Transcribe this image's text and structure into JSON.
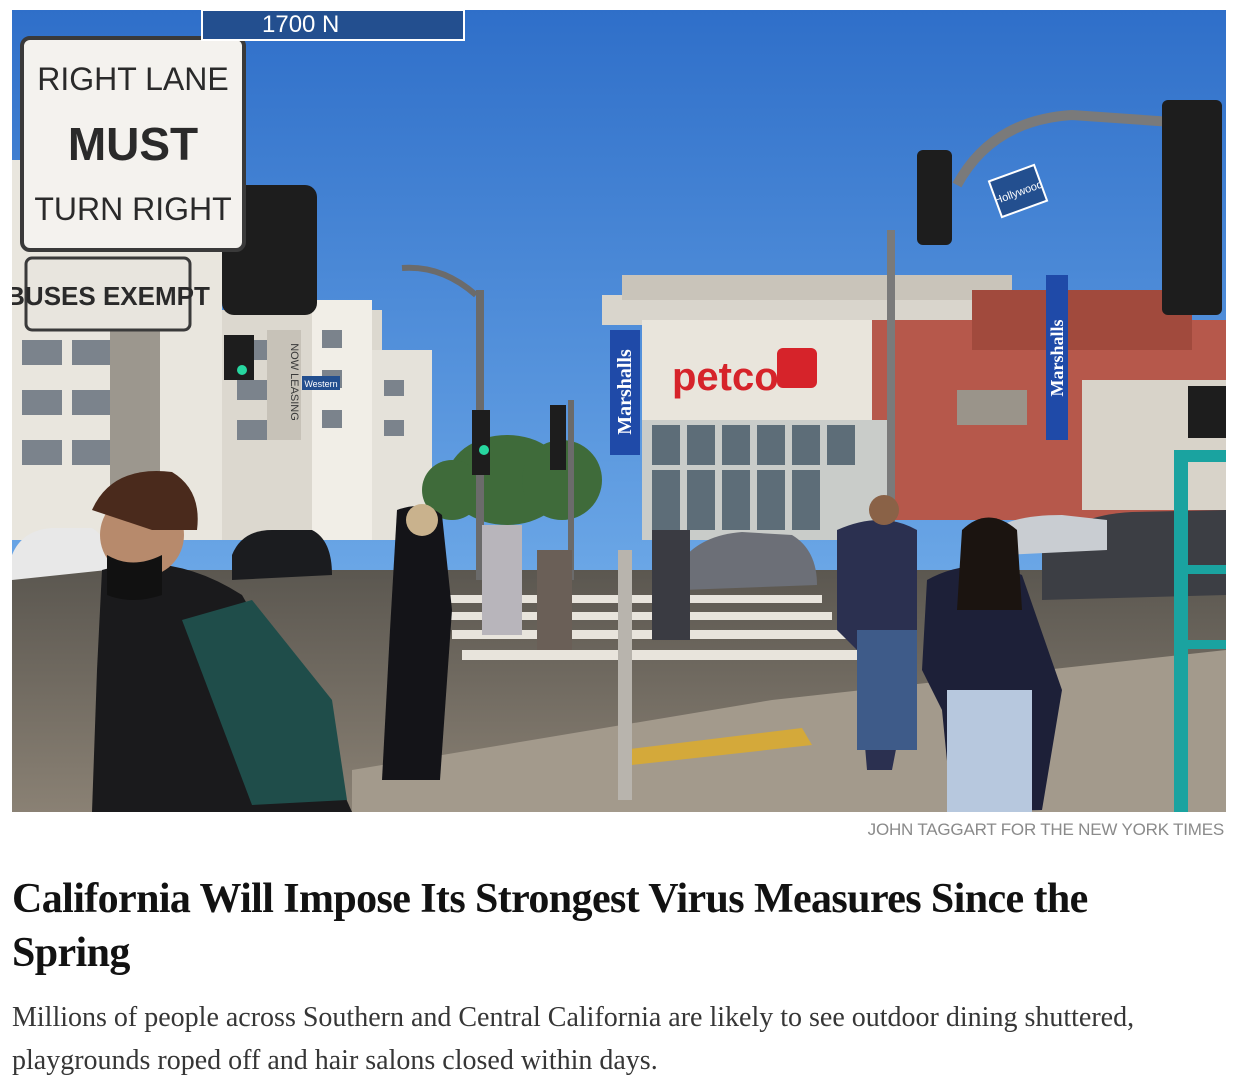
{
  "photo": {
    "signs": {
      "street_top": "1700 N",
      "right_lane_line1": "RIGHT LANE",
      "right_lane_line2": "MUST",
      "right_lane_line3": "TURN RIGHT",
      "buses_exempt": "BUSES EXEMPT",
      "hollywood": "Hollywood",
      "western": "Western",
      "petco": "petco",
      "marshalls_left": "Marshalls",
      "marshalls_right": "Marshalls",
      "now_leasing": "NOW LEASING"
    },
    "colors": {
      "sky": "#3f7fd0",
      "petco_red": "#d6232a",
      "marshalls_blue": "#1f4aa8",
      "teal_rail": "#1aa3a0"
    }
  },
  "article": {
    "credit": "JOHN TAGGART FOR THE NEW YORK TIMES",
    "headline": "California Will Impose Its Strongest Virus Measures Since the Spring",
    "summary": "Millions of people across Southern and Central California are likely to see outdoor dining shuttered, playgrounds roped off and hair salons closed within days."
  }
}
